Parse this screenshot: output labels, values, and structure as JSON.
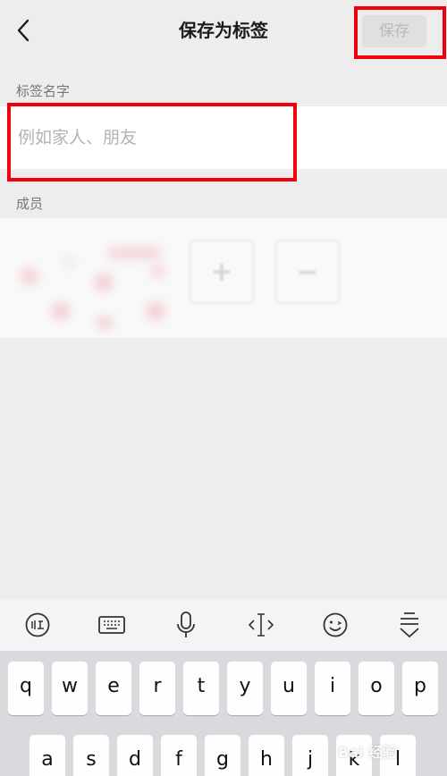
{
  "header": {
    "title": "保存为标签",
    "save_label": "保存"
  },
  "tag_name": {
    "section_label": "标签名字",
    "placeholder": "例如家人、朋友",
    "value": ""
  },
  "members": {
    "section_label": "成员",
    "add_symbol": "+",
    "remove_symbol": "−"
  },
  "keyboard": {
    "toolbar_icons": [
      "voice-input-icon",
      "keyboard-icon",
      "microphone-icon",
      "cursor-move-icon",
      "emoji-icon",
      "collapse-keyboard-icon"
    ],
    "row1": [
      "q",
      "w",
      "e",
      "r",
      "t",
      "y",
      "u",
      "i",
      "o",
      "p"
    ],
    "row2": [
      "a",
      "s",
      "d",
      "f",
      "g",
      "h",
      "j",
      "k",
      "l"
    ]
  },
  "watermark": {
    "text": "Bai 经验"
  },
  "colors": {
    "highlight_box": "#f0000d",
    "background": "#ededed",
    "save_disabled": "#b8b8b8"
  }
}
